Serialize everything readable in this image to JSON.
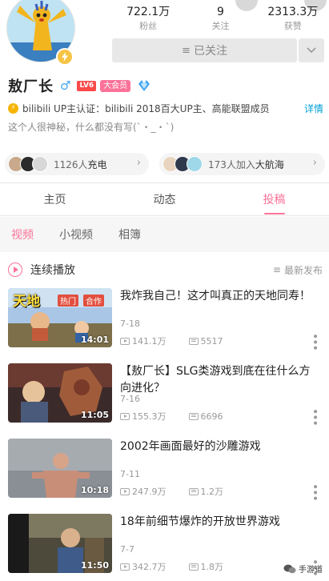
{
  "stats": [
    {
      "value": "722.1万",
      "label": "粉丝"
    },
    {
      "value": "9",
      "label": "关注"
    },
    {
      "value": "2313.3万",
      "label": "获赞"
    }
  ],
  "follow_button": {
    "label": "已关注",
    "icon": "menu-icon"
  },
  "follow_more": {
    "icon": "chevron-down-icon"
  },
  "profile": {
    "name": "敖厂长",
    "gender_icon": "male-icon",
    "gender_glyph": "♂",
    "level": "LV6",
    "vip_label": "大会员",
    "certification": "bilibili UP主认证：bilibili 2018百大UP主、高能联盟成员",
    "cert_detail": "详情",
    "signature": "这个人很神秘，什么都没有写(`・_・`)"
  },
  "fans_cards": [
    {
      "text_count": "1126人",
      "text_action": "充电"
    },
    {
      "text_count": "173人加入",
      "text_action": "大航海"
    }
  ],
  "tabs": [
    {
      "label": "主页",
      "active": false
    },
    {
      "label": "动态",
      "active": false
    },
    {
      "label": "投稿",
      "active": true
    }
  ],
  "subtabs": [
    {
      "label": "视频",
      "active": true
    },
    {
      "label": "小视频",
      "active": false
    },
    {
      "label": "相簿",
      "active": false
    }
  ],
  "play_bar": {
    "label": "连续播放",
    "sort_label": "最新发布"
  },
  "videos": [
    {
      "title": "我炸我自己！这才叫真正的天地同寿！",
      "date": "7-18",
      "views": "141.1万",
      "danmaku": "5517",
      "duration": "14:01",
      "thumb_text": "天地",
      "thumb_tag1": "热门",
      "thumb_tag2": "合作"
    },
    {
      "title": "【敖厂长】SLG类游戏到底在往什么方向进化？",
      "date": "7-16",
      "views": "155.3万",
      "danmaku": "6696",
      "duration": "11:05"
    },
    {
      "title": "2002年画面最好的沙雕游戏",
      "date": "7-11",
      "views": "247.9万",
      "danmaku": "1.2万",
      "duration": "10:18"
    },
    {
      "title": "18年前细节爆炸的开放世界游戏",
      "date": "7-7",
      "views": "342.7万",
      "danmaku": "1.8万",
      "duration": "11:50"
    }
  ],
  "watermark": {
    "text": "手游道"
  },
  "colors": {
    "accent": "#fb7299",
    "link": "#00a1d6",
    "male": "#46a6ef",
    "level": "#fa4a4a"
  }
}
